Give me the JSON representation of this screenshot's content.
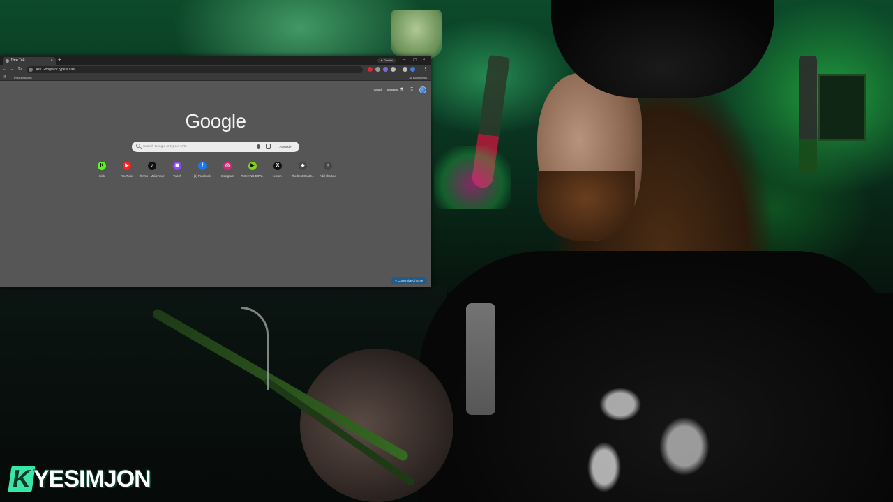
{
  "browser": {
    "tab_title": "New Tab",
    "tab_close": "×",
    "new_tab": "+",
    "gemini_label": "✦ Gemini",
    "window_controls": [
      "–",
      "▢",
      "×"
    ],
    "nav": {
      "back": "←",
      "forward": "→",
      "reload": "↻"
    },
    "omnibox_text": "Ask Google or type a URL",
    "extension_colors": [
      "#d8283a",
      "#9a9a9a",
      "#7a6ad8",
      "#bdbdbd",
      "#bdbdbd",
      "#3b7ee0",
      "#bdbdbd"
    ],
    "menu_icon": "⋮",
    "bookmarks": {
      "apps_icon": "⠿",
      "folder": "Product pages",
      "all": "All Bookmarks"
    }
  },
  "ntp": {
    "top_links": {
      "gmail": "Gmail",
      "images": "Images"
    },
    "labs_icon": "⚗",
    "apps_grid_icon": "⠿",
    "logo": "Google",
    "search_placeholder": "Search Google or type a URL",
    "ai_mode": "AI Mode",
    "shortcuts": [
      {
        "label": "Kick",
        "glyph": "K",
        "color": "#53fc18",
        "text_color": "#0a0a0a"
      },
      {
        "label": "YouTube",
        "glyph": "▶",
        "color": "#ff1f1f",
        "text_color": "#ffffff"
      },
      {
        "label": "TikTok - Make Your Day",
        "glyph": "♪",
        "color": "#111111",
        "text_color": "#ffffff"
      },
      {
        "label": "Twitch",
        "glyph": "◼",
        "color": "#9146ff",
        "text_color": "#ffffff"
      },
      {
        "label": "(1) Facebook",
        "glyph": "f",
        "color": "#1877f2",
        "text_color": "#ffffff"
      },
      {
        "label": "Instagram",
        "glyph": "◎",
        "color": "#d62976",
        "text_color": "#ffffff"
      },
      {
        "label": "R 3X AND EDW...",
        "glyph": "▶",
        "color": "#7fd41a",
        "text_color": "#0a0a0a"
      },
      {
        "label": "x.com",
        "glyph": "X",
        "color": "#111111",
        "text_color": "#ffffff"
      },
      {
        "label": "The best ChatB...",
        "glyph": "◆",
        "color": "#464646",
        "text_color": "#ffffff"
      },
      {
        "label": "Add shortcut",
        "glyph": "+",
        "color": "#464646",
        "text_color": "#e0e0e0"
      }
    ],
    "customize_label": "✎ Customize Chrome"
  },
  "overlay": {
    "brand_k": "K",
    "brand_name": "YESIMJON",
    "brand_color": "#39e6a8"
  }
}
